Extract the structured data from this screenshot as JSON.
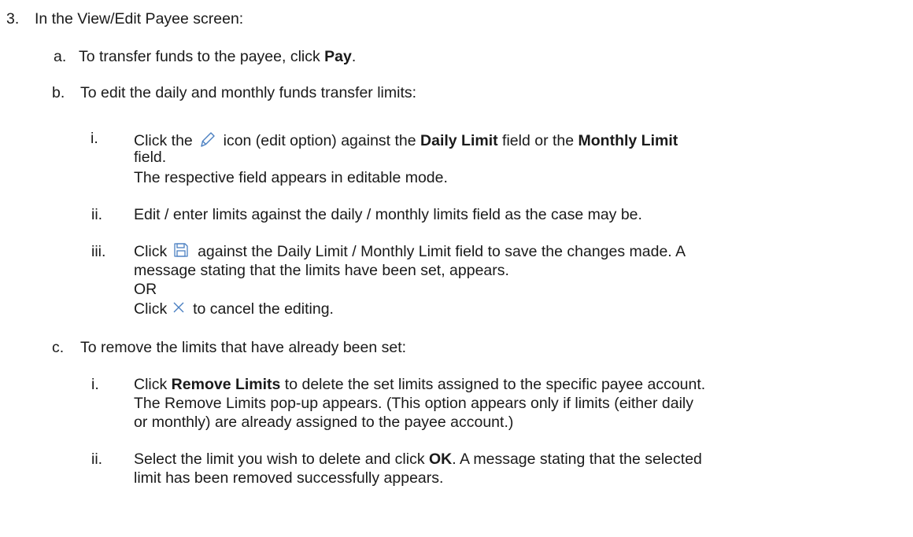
{
  "step3": {
    "num": "3.",
    "text": "In the View/Edit Payee screen:"
  },
  "a": {
    "num": "a.",
    "pre": "To transfer funds to the payee, click ",
    "bold": "Pay",
    "post": "."
  },
  "b": {
    "num": "b.",
    "text": "To edit the daily and monthly funds transfer limits:",
    "i": {
      "num": "i.",
      "click": "Click the ",
      "mid": " icon (edit option) against the ",
      "daily": "Daily Limit",
      "or": " field or the ",
      "monthly": "Monthly Limit",
      "field": "field.",
      "note": "The respective field appears in editable mode."
    },
    "ii": {
      "num": "ii.",
      "text": "Edit / enter limits against the daily / monthly limits field as the case may be."
    },
    "iii": {
      "num": "iii.",
      "click": "Click ",
      "after_save": " against the Daily Limit / Monthly Limit field to save the changes made. A",
      "line2": "message stating that the limits have been set, appears.",
      "or": "OR",
      "click2": "Click ",
      "after_cancel": " to cancel the editing."
    }
  },
  "c": {
    "num": "c.",
    "text": "To remove the limits that have already been set:",
    "i": {
      "num": "i.",
      "click": "Click ",
      "bold": "Remove Limits",
      "rest": " to delete the set limits assigned to the specific payee account.",
      "line2": "The Remove Limits pop-up appears. (This option appears only if limits (either daily",
      "line3": "or monthly) are already assigned to the payee account.)"
    },
    "ii": {
      "num": "ii.",
      "pre": "Select the limit you wish to delete and click ",
      "bold": "OK",
      "rest": ". A message stating that the selected",
      "line2": "limit has been removed successfully appears."
    }
  },
  "colors": {
    "icon": "#4a7fc1",
    "text": "#1a1a1a"
  },
  "icons": {
    "edit": "pencil-icon",
    "save": "save-icon",
    "cancel": "close-icon"
  }
}
